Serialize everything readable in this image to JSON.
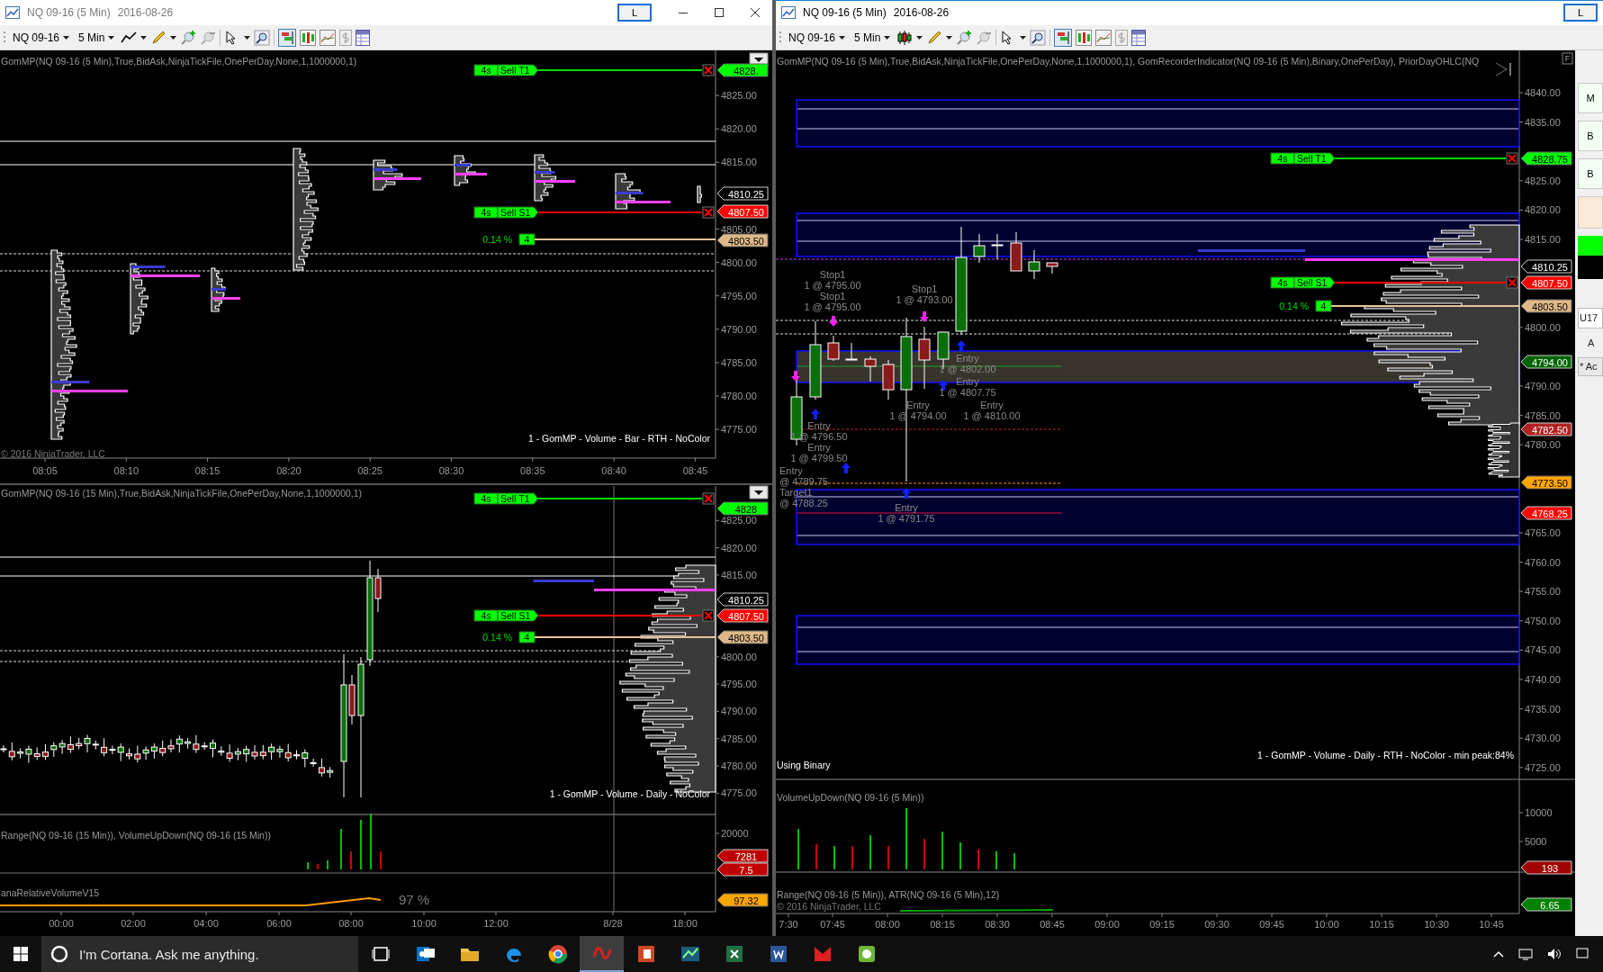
{
  "windows": [
    {
      "title": "NQ 09-16 (5 Min)",
      "date": "2016-08-26",
      "active": false,
      "link_button": "L",
      "toolbar": {
        "instrument": "NQ 09-16",
        "period": "5 Min"
      },
      "panes": [
        {
          "label": "GomMP(NQ 09-16 (5 Min),True,BidAsk,NinjaTickFile,OnePerDay,None,1,1000000,1)",
          "price_ticks": [
            "4825.00",
            "4820.00",
            "4815.00",
            "4805.00",
            "4800.00",
            "4795.00",
            "4790.00",
            "4785.00",
            "4780.00",
            "4775.00"
          ],
          "price_markers": [
            {
              "text": "4828.",
              "color": "#00ff00"
            },
            {
              "text": "4810.25",
              "color": "#000000"
            },
            {
              "text": "4807.50",
              "color": "#ff0000"
            },
            {
              "text": "4803.50",
              "color": "#deb887"
            }
          ],
          "orders": [
            {
              "kind": "target",
              "quantity": "4s",
              "label": "Sell T1"
            },
            {
              "kind": "stop",
              "quantity": "4s",
              "label": "Sell S1"
            },
            {
              "kind": "pnl",
              "reading": "0.14 %",
              "quantity": "4"
            }
          ],
          "footer": "1 - GomMP  - Volume - Bar - RTH - NoColor",
          "copyright": "© 2016 NinjaTrader, LLC",
          "time_ticks": [
            "08:05",
            "08:10",
            "08:15",
            "08:20",
            "08:25",
            "08:30",
            "08:35",
            "08:40",
            "08:45"
          ]
        },
        {
          "label": "GomMP(NQ 09-16 (15 Min),True,BidAsk,NinjaTickFile,OnePerDay,None,1,1000000,1)",
          "price_ticks": [
            "4825.00",
            "4820.00",
            "4815.00",
            "4800.00",
            "4795.00",
            "4790.00",
            "4785.00",
            "4780.00",
            "4775.00"
          ],
          "price_markers": [
            {
              "text": "4828",
              "color": "#00ff00"
            },
            {
              "text": "4810.25",
              "color": "#000000"
            },
            {
              "text": "4807.50",
              "color": "#ff0000"
            },
            {
              "text": "4803.50",
              "color": "#deb887"
            }
          ],
          "orders": [
            {
              "kind": "target",
              "quantity": "4s",
              "label": "Sell T1"
            },
            {
              "kind": "stop",
              "quantity": "4s",
              "label": "Sell S1"
            },
            {
              "kind": "pnl",
              "reading": "0.14 %",
              "quantity": "4"
            }
          ],
          "footer": "1 - GomMP  - Volume - Daily - NoColor"
        },
        {
          "label": "Range(NQ 09-16 (15 Min)), VolumeUpDown(NQ 09-16 (15 Min))",
          "price_ticks": [
            "20000"
          ],
          "price_markers": [
            {
              "text": "7281",
              "color": "#c00000"
            },
            {
              "text": "7.5",
              "color": "#c00000"
            }
          ]
        },
        {
          "label": "anaRelativeVolumeV15",
          "reading": "97 %",
          "price_markers": [
            {
              "text": "97.32",
              "color": "#ffa500"
            }
          ],
          "time_ticks": [
            "00:00",
            "02:00",
            "04:00",
            "06:00",
            "08:00",
            "10:00",
            "12:00",
            "8/28",
            "18:00"
          ]
        }
      ]
    },
    {
      "title": "NQ 09-16 (5 Min)",
      "date": "2016-08-26",
      "active": true,
      "link_button": "L",
      "toolbar": {
        "instrument": "NQ 09-16",
        "period": "5 Min"
      },
      "panes": [
        {
          "label": "GomMP(NQ 09-16 (5 Min),True,BidAsk,NinjaTickFile,OnePerDay,None,1,1000000,1), GomRecorderIndicator(NQ 09-16 (5 Min),Binary,OnePerDay), PriorDayOHLC(NQ",
          "panel_button": "F",
          "price_ticks": [
            "4840.00",
            "4835.00",
            "4825.00",
            "4820.00",
            "4815.00",
            "4800.00",
            "4790.00",
            "4785.00",
            "4780.00",
            "4765.00",
            "4760.00",
            "4755.00",
            "4750.00",
            "4745.00",
            "4740.00",
            "4735.00",
            "4730.00",
            "4725.00"
          ],
          "price_markers": [
            {
              "text": "4828.75",
              "color": "#00ff00"
            },
            {
              "text": "4810.25",
              "color": "#000000"
            },
            {
              "text": "4807.50",
              "color": "#ff0000"
            },
            {
              "text": "4803.50",
              "color": "#deb887"
            },
            {
              "text": "4794.00",
              "color": "#006400"
            },
            {
              "text": "4782.50",
              "color": "#b22222"
            },
            {
              "text": "4773.50",
              "color": "#ffa500"
            },
            {
              "text": "4768.25",
              "color": "#ff0000"
            }
          ],
          "orders": [
            {
              "kind": "target",
              "quantity": "4s",
              "label": "Sell T1"
            },
            {
              "kind": "stop",
              "quantity": "4s",
              "label": "Sell S1"
            },
            {
              "kind": "pnl",
              "reading": "0.14 %",
              "quantity": "4"
            }
          ],
          "executions": [
            {
              "title": "Stop1",
              "detail": "1 @ 4795.00"
            },
            {
              "title": "Stop1",
              "detail": "1 @ 4795.00"
            },
            {
              "title": "Stop1",
              "detail": "1 @ 4793.00"
            },
            {
              "title": "Entry",
              "detail": "1 @ 4802.00"
            },
            {
              "title": "Entry",
              "detail": "1 @ 4807.75"
            },
            {
              "title": "Entry",
              "detail": "1 @ 4794.00"
            },
            {
              "title": "Entry",
              "detail": "1 @ 4810.00"
            },
            {
              "title": "Entry",
              "detail": "1 @ 4796.50"
            },
            {
              "title": "Entry",
              "detail": "1 @ 4799.50"
            },
            {
              "title": "Entry",
              "detail": "@ 4789.75"
            },
            {
              "title": "Target1",
              "detail": "@ 4788.25"
            },
            {
              "title": "Entry",
              "detail": "1 @ 4791.75"
            }
          ],
          "note": "Using Binary",
          "footer": "1 - GomMP  - Volume - Daily - RTH - NoColor - min peak:84%"
        },
        {
          "label": "VolumeUpDown(NQ 09-16 (5 Min))",
          "price_ticks": [
            "10000",
            "5000"
          ],
          "price_markers": [
            {
              "text": "193",
              "color": "#a00000"
            }
          ]
        },
        {
          "label": "Range(NQ 09-16 (5 Min)), ATR(NQ 09-16 (5 Min),12)",
          "copyright": "© 2016 NinjaTrader, LLC",
          "price_markers": [
            {
              "text": "6.65",
              "color": "#008000"
            }
          ],
          "time_ticks": [
            "7:30",
            "07:45",
            "08:00",
            "08:15",
            "08:30",
            "08:45",
            "09:00",
            "09:15",
            "09:30",
            "09:45",
            "10:00",
            "10:15",
            "10:30",
            "10:45"
          ]
        }
      ],
      "side_panel": {
        "buttons": [
          "M",
          "B",
          "B"
        ],
        "field": "U17",
        "label": "A",
        "dropdown": "* Ac"
      }
    }
  ],
  "taskbar": {
    "placeholder": "I'm Cortana. Ask me anything.",
    "apps": [
      {
        "selected": false
      },
      {
        "selected": false
      },
      {
        "selected": false
      },
      {
        "selected": false
      },
      {
        "selected": true
      },
      {
        "selected": false
      },
      {
        "selected": false
      },
      {
        "selected": false
      },
      {
        "selected": false
      },
      {
        "selected": false
      },
      {
        "selected": false
      }
    ]
  }
}
